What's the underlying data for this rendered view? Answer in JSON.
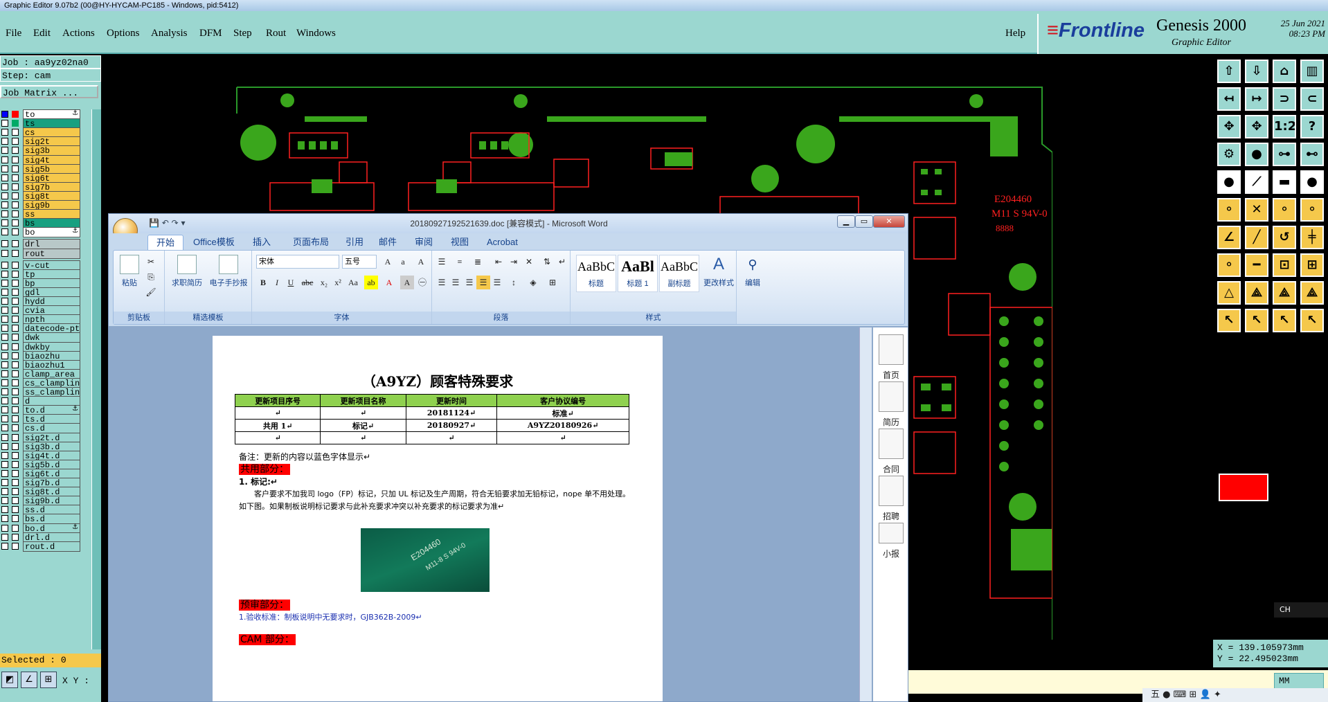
{
  "genesis": {
    "title_bar": "Graphic Editor 9.07b2 (00@HY-HYCAM-PC185 - Windows, pid:5412)",
    "menu": [
      "File",
      "Edit",
      "Actions",
      "Options",
      "Analysis",
      "DFM",
      "Step",
      "Rout",
      "Windows"
    ],
    "help": "Help",
    "brand": "Frontline",
    "product": "Genesis 2000",
    "subtitle": "Graphic Editor",
    "date": "25 Jun 2021",
    "time": "08:23 PM",
    "job": "Job : aa9yz02na0",
    "step": "Step: cam",
    "job_matrix": "Job Matrix ...",
    "selected": "Selected : 0",
    "xy_label": "X Y :",
    "coord_x": "X = 139.105973mm",
    "coord_y": "Y = 22.495023mm",
    "units": "MM",
    "ime": "CH",
    "taskbar": "五 ● ⌨ ⊞ 👤 ✦",
    "layers": [
      {
        "name": "to",
        "color": "#ffffff",
        "dot": "#0000ff",
        "dot2": "#ff0000",
        "extra": "⚓"
      },
      {
        "name": "ts",
        "color": "#18a080",
        "dot": "",
        "dot2": "#0a6"
      },
      {
        "name": "cs",
        "color": "#f5c84b"
      },
      {
        "name": "sig2t",
        "color": "#f5c84b"
      },
      {
        "name": "sig3b",
        "color": "#f5c84b"
      },
      {
        "name": "sig4t",
        "color": "#f5c84b"
      },
      {
        "name": "sig5b",
        "color": "#f5c84b"
      },
      {
        "name": "sig6t",
        "color": "#f5c84b"
      },
      {
        "name": "sig7b",
        "color": "#f5c84b"
      },
      {
        "name": "sig8t",
        "color": "#f5c84b"
      },
      {
        "name": "sig9b",
        "color": "#f5c84b"
      },
      {
        "name": "ss",
        "color": "#f5c84b"
      },
      {
        "name": "bs",
        "color": "#18a080"
      },
      {
        "name": "bo",
        "color": "#ffffff",
        "extra": "⚓"
      },
      {
        "name": "drl",
        "color": "#b8c8c8"
      },
      {
        "name": "rout",
        "color": "#b8c8c8"
      },
      {
        "name": "v-cut",
        "color": "#9bd7d0"
      },
      {
        "name": "tp",
        "color": "#9bd7d0"
      },
      {
        "name": "bp",
        "color": "#9bd7d0"
      },
      {
        "name": "gdl",
        "color": "#9bd7d0"
      },
      {
        "name": "hydd",
        "color": "#9bd7d0"
      },
      {
        "name": "cvia",
        "color": "#9bd7d0"
      },
      {
        "name": "npth",
        "color": "#9bd7d0"
      },
      {
        "name": "datecode-pts",
        "color": "#9bd7d0"
      },
      {
        "name": "dwk",
        "color": "#9bd7d0"
      },
      {
        "name": "dwkby",
        "color": "#9bd7d0"
      },
      {
        "name": "biaozhu",
        "color": "#9bd7d0"
      },
      {
        "name": "biaozhu1",
        "color": "#9bd7d0"
      },
      {
        "name": "clamp_area",
        "color": "#9bd7d0"
      },
      {
        "name": "cs_clampline",
        "color": "#9bd7d0"
      },
      {
        "name": "ss_clampline",
        "color": "#9bd7d0"
      },
      {
        "name": "d",
        "color": "#9bd7d0"
      },
      {
        "name": "to.d",
        "color": "#9bd7d0",
        "extra": "⚓"
      },
      {
        "name": "ts.d",
        "color": "#9bd7d0"
      },
      {
        "name": "cs.d",
        "color": "#9bd7d0"
      },
      {
        "name": "sig2t.d",
        "color": "#9bd7d0"
      },
      {
        "name": "sig3b.d",
        "color": "#9bd7d0"
      },
      {
        "name": "sig4t.d",
        "color": "#9bd7d0"
      },
      {
        "name": "sig5b.d",
        "color": "#9bd7d0"
      },
      {
        "name": "sig6t.d",
        "color": "#9bd7d0"
      },
      {
        "name": "sig7b.d",
        "color": "#9bd7d0"
      },
      {
        "name": "sig8t.d",
        "color": "#9bd7d0"
      },
      {
        "name": "sig9b.d",
        "color": "#9bd7d0"
      },
      {
        "name": "ss.d",
        "color": "#9bd7d0"
      },
      {
        "name": "bs.d",
        "color": "#9bd7d0"
      },
      {
        "name": "bo.d",
        "color": "#9bd7d0",
        "extra": "⚓"
      },
      {
        "name": "drl.d",
        "color": "#9bd7d0"
      },
      {
        "name": "rout.d",
        "color": "#9bd7d0"
      }
    ],
    "pcb_labels": [
      "E204460",
      "M11 S 94V-0",
      "8888"
    ]
  },
  "word": {
    "title": "20180927192521639.doc [兼容模式] - Microsoft Word",
    "tabs": [
      "开始",
      "Office模板",
      "插入",
      "页面布局",
      "引用",
      "邮件",
      "审阅",
      "视图",
      "Acrobat"
    ],
    "groups": [
      "剪贴板",
      "精选模板",
      "字体",
      "段落",
      "样式"
    ],
    "paste": "粘贴",
    "tpl1": "求职简历",
    "tpl2": "电子手抄报",
    "font_name": "宋体",
    "font_size": "五号",
    "styles": [
      {
        "preview": "AaBbC",
        "name": "标题"
      },
      {
        "preview": "AaBl",
        "name": "标题 1"
      },
      {
        "preview": "AaBbC",
        "name": "副标题"
      }
    ],
    "change_styles": "更改样式",
    "edit": "编辑",
    "doc_title": "（A9YZ）顾客特殊要求",
    "table_headers": [
      "更新项目序号",
      "更新项目名称",
      "更新时间",
      "客户协议编号"
    ],
    "table_rows": [
      [
        "↵",
        "↵",
        "20181124↵",
        "标准↵"
      ],
      [
        "共用 1↵",
        "标记↵",
        "20180927↵",
        "A9YZ20180926↵"
      ],
      [
        "↵",
        "↵",
        "↵",
        "↵"
      ]
    ],
    "note": "备注：更新的内容以蓝色字体显示↵",
    "sec_common": "共用部分：",
    "item1": "1. 标记:↵",
    "para1": "客户要求不加我司 logo（FP）标记，只加 UL 标记及生产周期，符合无铅要求加无铅标记，nope 单不用处理。",
    "para2": "如下图。如果制板说明标记要求与此补充要求冲突以补充要求的标记要求为准↵",
    "photo_text": "E204460",
    "photo_text2": "M11-8 S 94V-0",
    "sec_preaudit": "预审部分：",
    "pre_item": "1.验收标准：制板说明中无要求时，GJB362B-2009↵",
    "sec_cam": "CAM 部分：",
    "side": [
      "首页",
      "简历",
      "合同",
      "招聘",
      "小报"
    ]
  }
}
